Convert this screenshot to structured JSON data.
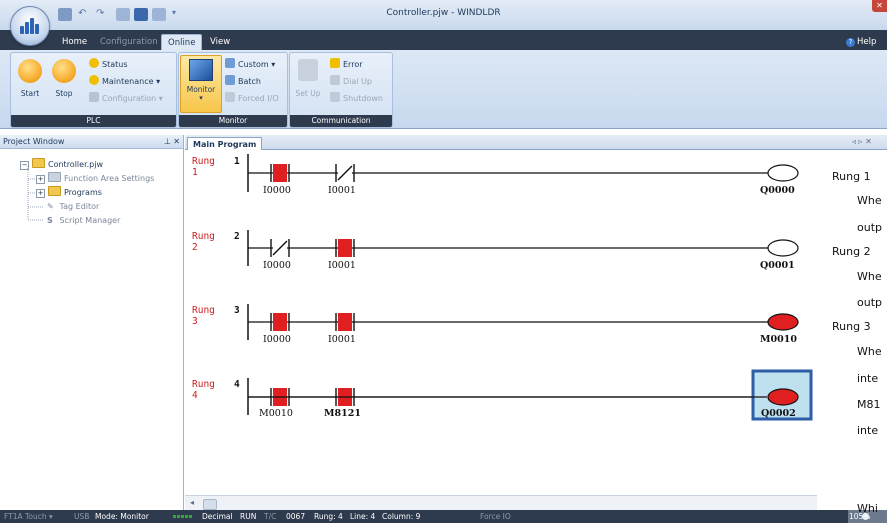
{
  "window": {
    "title": "Controller.pjw - WINDLDR"
  },
  "tabs": [
    "Home",
    "Configuration",
    "Online",
    "View"
  ],
  "help_label": "Help",
  "ribbon": {
    "plc": {
      "start": "Start",
      "stop": "Stop",
      "status": "Status",
      "maintenance": "Maintenance",
      "configuration": "Configuration",
      "label": "PLC"
    },
    "monitor": {
      "monitor": "Monitor",
      "custom": "Custom",
      "batch": "Batch",
      "forced_io": "Forced I/O",
      "label": "Monitor"
    },
    "communication": {
      "setup": "Set Up",
      "error": "Error",
      "dial_up": "Dial Up",
      "shutdown": "Shutdown",
      "label": "Communication"
    }
  },
  "project": {
    "title": "Project Window",
    "root": "Controller.pjw",
    "items": [
      "Function Area Settings",
      "Programs",
      "Tag Editor",
      "Script Manager"
    ]
  },
  "main": {
    "tab": "Main Program",
    "rungs": [
      {
        "label1": "Rung",
        "label2": "1",
        "num": "1",
        "contacts": [
          "I0000",
          "I0001"
        ],
        "coil": "Q0000"
      },
      {
        "label1": "Rung",
        "label2": "2",
        "num": "2",
        "contacts": [
          "I0000",
          "I0001"
        ],
        "coil": "Q0001"
      },
      {
        "label1": "Rung",
        "label2": "3",
        "num": "3",
        "contacts": [
          "I0000",
          "I0001"
        ],
        "coil": "M0010"
      },
      {
        "label1": "Rung",
        "label2": "4",
        "num": "4",
        "contacts": [
          "M0010",
          "M8121"
        ],
        "coil": "Q0002"
      }
    ]
  },
  "explanation": [
    "Rung 1",
    "Whe",
    "outp",
    "Rung 2",
    "Whe",
    "outp",
    "Rung 3",
    "Whe",
    "inte",
    "M81",
    "inte",
    "Whi"
  ],
  "status": {
    "device": "FT1A Touch",
    "port": "USB",
    "mode": "Mode: Monitor",
    "format": "Decimal",
    "run": "RUN",
    "tc": "T/C",
    "count": "0067",
    "rung": "Rung: 4",
    "line": "Line: 4",
    "column": "Column: 9",
    "force": "Force IO",
    "zoom": "105%"
  },
  "colors": {
    "accent_red": "#e02020",
    "energized": "#e02020",
    "frame": "#2e3a4d"
  }
}
